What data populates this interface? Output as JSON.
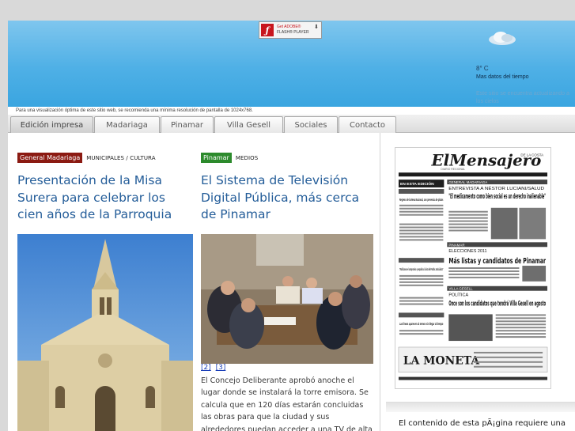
{
  "flash": {
    "line1": "Get ADOBE®",
    "line2": "FLASH® PLAYER",
    "icon": "flash-icon",
    "download_icon": "download-arrow-icon"
  },
  "weather": {
    "icon": "cloud-icon",
    "temp": "8° C",
    "link": "Mas datos del tiempo",
    "note": "Este sitio se encuentra actualizando a los cielos"
  },
  "resolution_note": "Para una visualización óptima de este sitio web, se recomienda una mínima resolución de pantalla de 1024x768.",
  "nav": {
    "tabs": [
      {
        "label": "Edición impresa",
        "active": true
      },
      {
        "label": "Madariaga",
        "active": false
      },
      {
        "label": "Pinamar",
        "active": false
      },
      {
        "label": "Villa Gesell",
        "active": false
      },
      {
        "label": "Sociales",
        "active": false
      },
      {
        "label": "Contacto",
        "active": false
      }
    ]
  },
  "article_left": {
    "tag": "General Madariaga",
    "kicker": "MUNICIPALES / CULTURA",
    "title": "Presentación de la Misa Surera para celebrar los cien años de la Parroquia"
  },
  "article_middle": {
    "tag": "Pinamar",
    "kicker": "MEDIOS",
    "title": "El Sistema de Televisión Digital Pública, más cerca de Pinamar",
    "image_links": [
      "[2]",
      "[3]"
    ],
    "body": "El Concejo Deliberante aprobó anoche el lugar donde se instalará la torre emisora. Se calcula que en 120 días estarán concluidas las obras para que la ciudad y sus alrededores puedan acceder a una TV de alta calidad y sin costo"
  },
  "newspaper": {
    "masthead": "ElMensajero",
    "masthead_small": "DE LA COSTA",
    "subtitle": "DIARIO REGIONAL",
    "headline1_section": "GENERAL MADARIAGA",
    "headline1_kicker": "ENTREVISTA A NÉSTOR LUCIANI/SALUD",
    "headline1": "\"El medicamento como bien social es un derecho inalienable\"",
    "headline2_section": "PINAMAR",
    "headline2_kicker": "ELECCIONES 2011",
    "headline2": "Más listas y candidatos de Pinamar",
    "headline3_section": "VILLA GESELL",
    "headline3_kicker": "POLÍTICA",
    "headline3": "Once son los candidatos que tendrá Villa Gesell en agosto",
    "side_label": "EN ESTA EDICIÓN",
    "side_headline1": "Regreso de la Mesa Nacional, con presencia de platos",
    "side_headline2": "\"Ratificamos el compromiso y respaldo a la lista del Partido Justicialista\"",
    "side_headline3": "Las líneas aparecen al menos sin llegar al tiempo",
    "ad": "LA MONETA"
  },
  "bottom_notice": "El contenido de esta pÃ¡gina requiere una"
}
